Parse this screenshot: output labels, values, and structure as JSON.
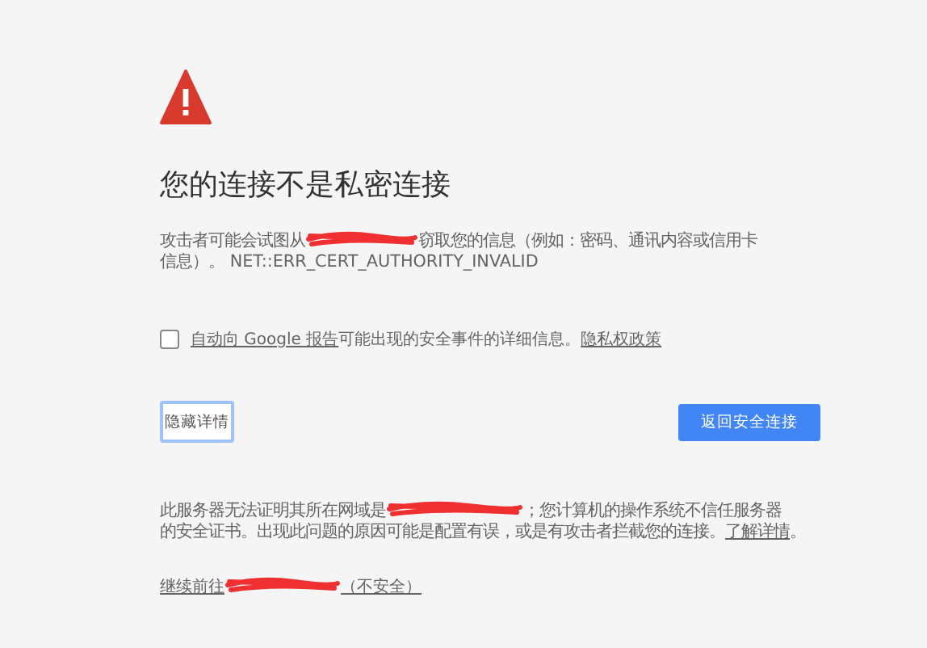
{
  "title": "您的连接不是私密连接",
  "description": {
    "before": "攻击者可能会试图从",
    "after": "窃取您的信息（例如：密码、通讯内容或信用卡",
    "line_2": "信息）。",
    "error_code": "NET::ERR_CERT_AUTHORITY_INVALID"
  },
  "report": {
    "checked": false,
    "link": "自动向 Google 报告",
    "text": "可能出现的安全事件的详细信息。",
    "privacy_link": "隐私权政策"
  },
  "buttons": [
    {
      "kind": "secondary",
      "label": "隐藏详情",
      "focused": true
    },
    {
      "kind": "primary",
      "label": "返回安全连接",
      "focused": false
    }
  ],
  "details": {
    "before": "此服务器无法证明其所在网域是",
    "after": "；您计算机的操作系统不信任服务器",
    "line_2": "的安全证书。出现此问题的原因可能是配置有误，或是有攻击者拦截您的连接。",
    "learn_more": "了解详情",
    "end": "。"
  },
  "proceed": {
    "before": "继续前往",
    "after": "（不安全）"
  }
}
